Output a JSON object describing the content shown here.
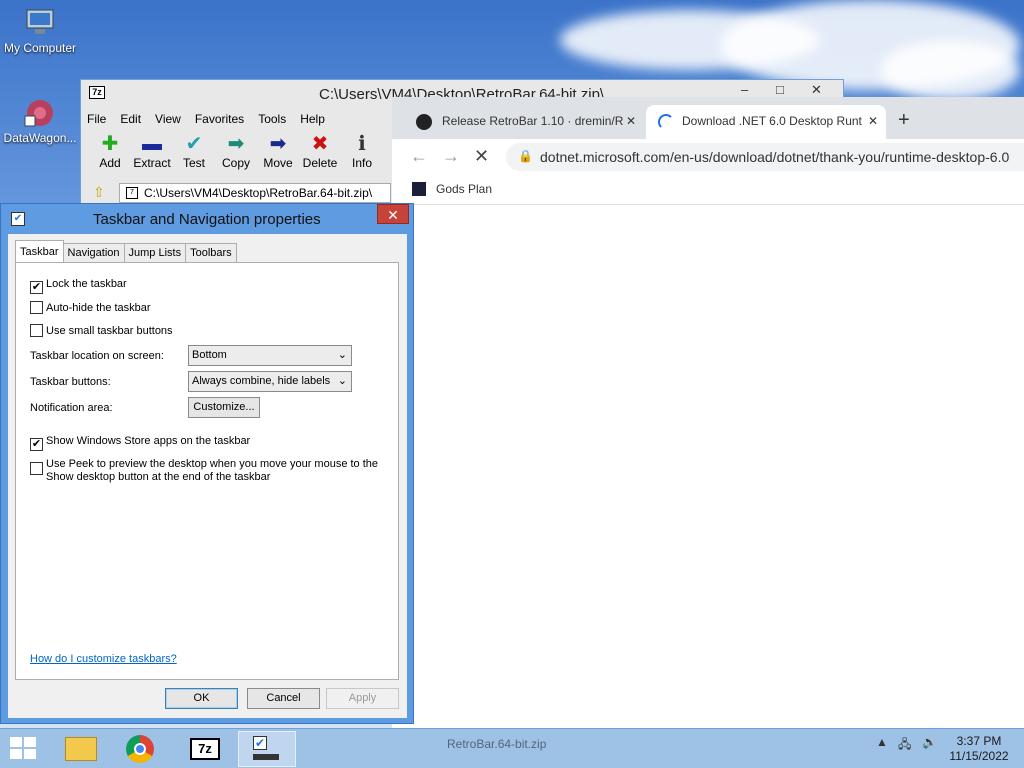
{
  "desktop": {
    "icons": [
      {
        "label": "My Computer"
      },
      {
        "label": "DataWagon..."
      }
    ]
  },
  "zip": {
    "title": "C:\\Users\\VM4\\Desktop\\RetroBar.64-bit.zip\\",
    "logo": "7z",
    "menu": [
      "File",
      "Edit",
      "View",
      "Favorites",
      "Tools",
      "Help"
    ],
    "toolbar": [
      {
        "label": "Add",
        "glyph": "✚",
        "color": "#22aa22"
      },
      {
        "label": "Extract",
        "glyph": "▬",
        "color": "#1a2a9c"
      },
      {
        "label": "Test",
        "glyph": "✔",
        "color": "#20a0b0"
      },
      {
        "label": "Copy",
        "glyph": "➡",
        "color": "#1a8a7a"
      },
      {
        "label": "Move",
        "glyph": "➡",
        "color": "#1a2a8c"
      },
      {
        "label": "Delete",
        "glyph": "✖",
        "color": "#cc1111"
      },
      {
        "label": "Info",
        "glyph": "ℹ",
        "color": "#333333"
      }
    ],
    "path": "C:\\Users\\VM4\\Desktop\\RetroBar.64-bit.zip\\"
  },
  "browser": {
    "tabs": [
      {
        "title": "Release RetroBar 1.10 · dremin/R",
        "close": "✕"
      },
      {
        "title": "Download .NET 6.0 Desktop Runt",
        "close": "✕"
      }
    ],
    "new_tab": "+",
    "back": "←",
    "forward": "→",
    "stop": "✕",
    "url": "dotnet.microsoft.com/en-us/download/dotnet/thank-you/runtime-desktop-6.0",
    "bookmark": "Gods Plan"
  },
  "dialog": {
    "title": "Taskbar and Navigation properties",
    "close": "✕",
    "tabs": [
      "Taskbar",
      "Navigation",
      "Jump Lists",
      "Toolbars"
    ],
    "lock_taskbar": {
      "label": "Lock the taskbar",
      "checked": "✔"
    },
    "autohide": {
      "label": "Auto-hide the taskbar",
      "checked": ""
    },
    "small_buttons": {
      "label": "Use small taskbar buttons",
      "checked": ""
    },
    "location_label": "Taskbar location on screen:",
    "location_value": "Bottom",
    "buttons_label": "Taskbar buttons:",
    "buttons_value": "Always combine, hide labels",
    "notification_label": "Notification area:",
    "customize": "Customize...",
    "store_apps": {
      "label": "Show Windows Store apps on the taskbar",
      "checked": "✔"
    },
    "peek": {
      "label_1": "Use Peek to preview the desktop when you move your mouse to the",
      "label_2": "Show desktop button at the end of the taskbar",
      "checked": ""
    },
    "help_link": "How do I customize taskbars?",
    "ok": "OK",
    "cancel": "Cancel",
    "apply": "Apply"
  },
  "taskbar": {
    "ghost_label": "RetroBar.64-bit.zip",
    "clock_time": "3:37 PM",
    "clock_date": "11/15/2022",
    "tray": [
      "▲",
      "🖧",
      "🔊"
    ]
  }
}
